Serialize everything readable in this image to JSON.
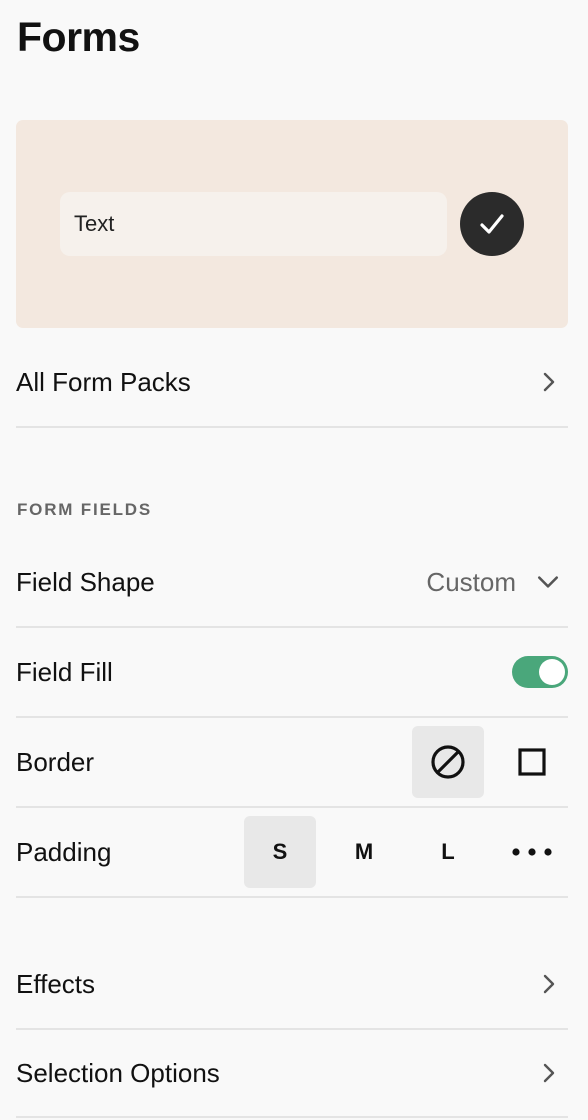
{
  "page": {
    "title": "Forms"
  },
  "preview": {
    "input_text": "Text",
    "submit_icon": "checkmark-icon"
  },
  "all_form_packs": {
    "label": "All Form Packs"
  },
  "form_fields": {
    "section_label": "FORM FIELDS",
    "field_shape": {
      "label": "Field Shape",
      "value": "Custom"
    },
    "field_fill": {
      "label": "Field Fill",
      "enabled": true
    },
    "border": {
      "label": "Border",
      "options": [
        "none-icon",
        "square-icon"
      ],
      "selected": "none-icon"
    },
    "padding": {
      "label": "Padding",
      "options": [
        "S",
        "M",
        "L"
      ],
      "selected": "S",
      "more_icon": "more-icon"
    }
  },
  "effects": {
    "label": "Effects"
  },
  "selection_options": {
    "label": "Selection Options"
  },
  "colors": {
    "preview_bg": "#f3e8df",
    "toggle_on": "#4aa77b",
    "submit_bg": "#2b2b2b"
  }
}
